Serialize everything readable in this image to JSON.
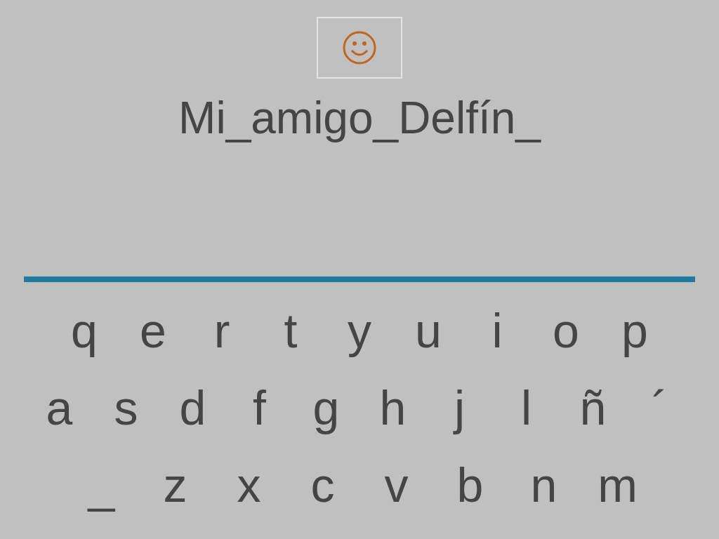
{
  "answer": "Mi_amigo_Delfín_",
  "keyboard": {
    "rows": [
      [
        "q",
        "e",
        "r",
        "t",
        "y",
        "u",
        "i",
        "o",
        "p"
      ],
      [
        "a",
        "s",
        "d",
        "f",
        "g",
        "h",
        "j",
        "l",
        "ñ",
        "´"
      ],
      [
        "_",
        "z",
        "x",
        "c",
        "v",
        "b",
        "n",
        "m"
      ]
    ]
  }
}
